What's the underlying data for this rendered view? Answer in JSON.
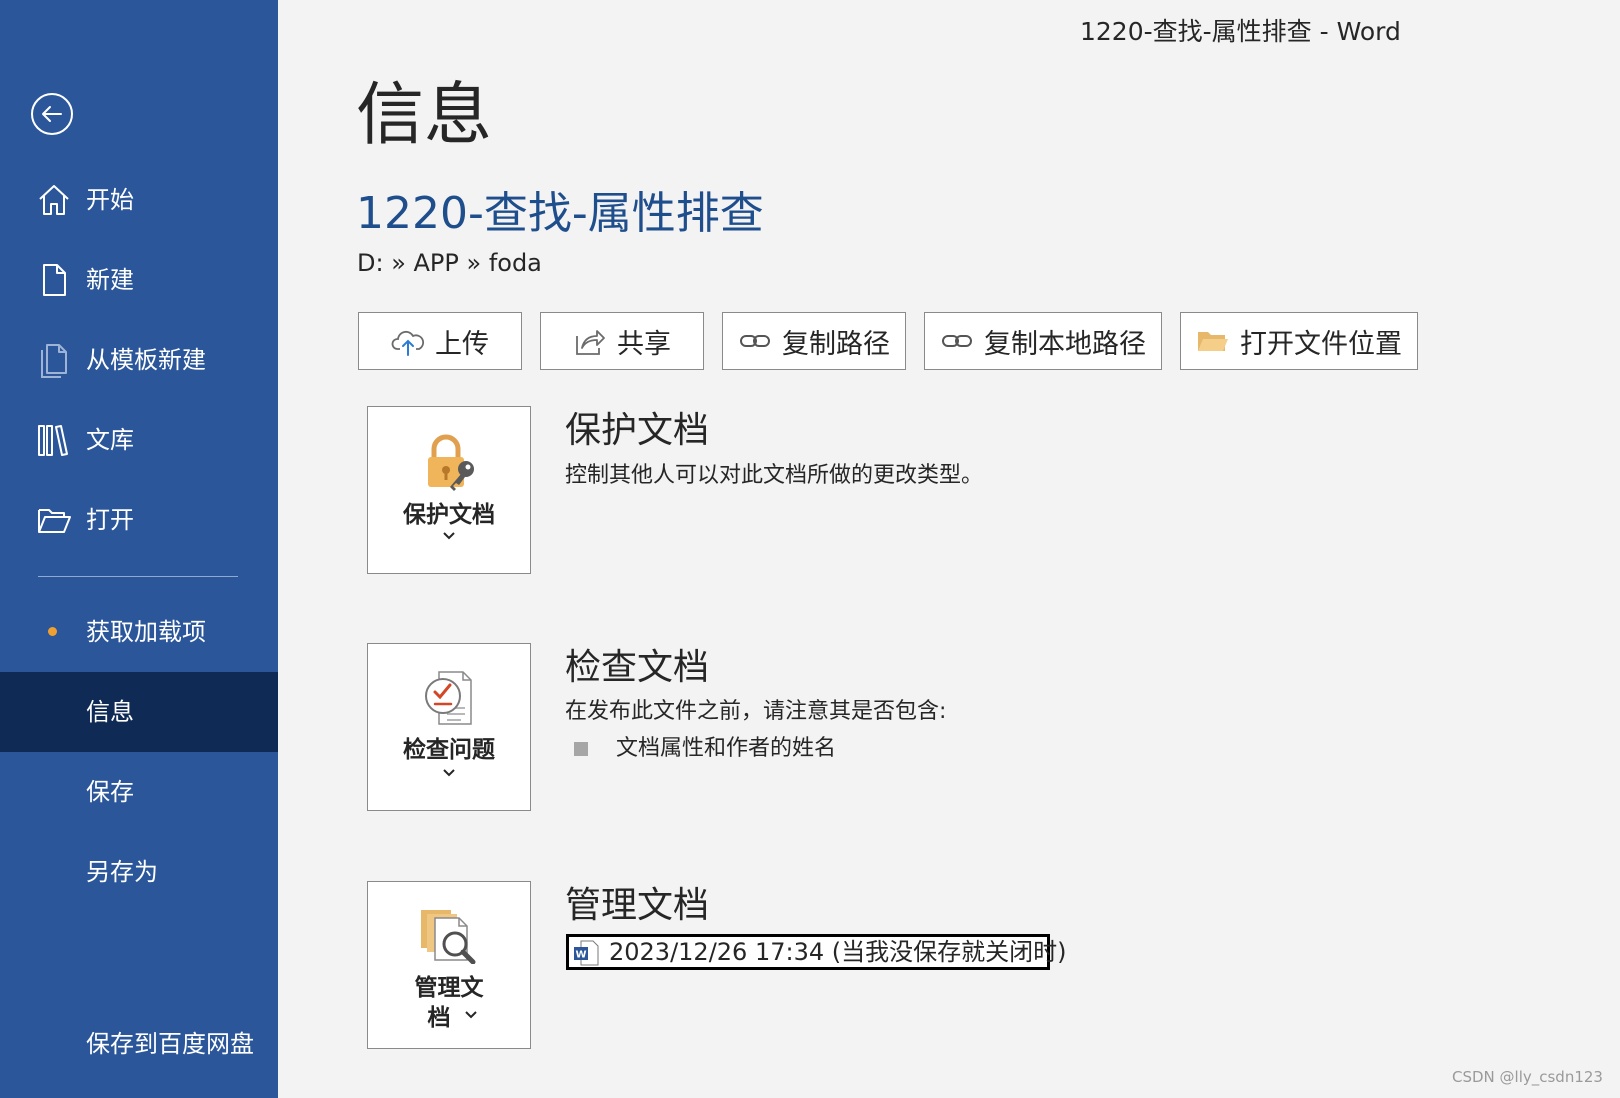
{
  "window": {
    "title": "1220-查找-属性排查  -  Word"
  },
  "sidebar": {
    "items": [
      {
        "label": "开始",
        "icon": "home-icon"
      },
      {
        "label": "新建",
        "icon": "new-document-icon"
      },
      {
        "label": "从模板新建",
        "icon": "template-icon"
      },
      {
        "label": "文库",
        "icon": "library-icon"
      },
      {
        "label": "打开",
        "icon": "open-folder-icon"
      },
      {
        "label": "获取加载项"
      },
      {
        "label": "信息",
        "active": true
      },
      {
        "label": "保存"
      },
      {
        "label": "另存为"
      },
      {
        "label": "保存到百度网盘"
      }
    ]
  },
  "main": {
    "title": "信息",
    "doc_title": "1220-查找-属性排查",
    "path": "D: » APP » foda",
    "actions": [
      {
        "label": "上传",
        "icon": "cloud-upload-icon"
      },
      {
        "label": "共享",
        "icon": "share-icon"
      },
      {
        "label": "复制路径",
        "icon": "link-icon"
      },
      {
        "label": "复制本地路径",
        "icon": "link-icon"
      },
      {
        "label": "打开文件位置",
        "icon": "folder-icon"
      }
    ],
    "protect": {
      "button_label": "保护文档",
      "title": "保护文档",
      "description": "控制其他人可以对此文档所做的更改类型。"
    },
    "inspect": {
      "button_label": "检查问题",
      "title": "检查文档",
      "description": "在发布此文件之前，请注意其是否包含:",
      "bullets": [
        "文档属性和作者的姓名"
      ]
    },
    "manage": {
      "button_label_line1": "管理文",
      "button_label_line2": "档",
      "title": "管理文档",
      "version_entry": "2023/12/26 17:34 (当我没保存就关闭时)"
    }
  },
  "watermark": "CSDN @lly_csdn123",
  "colors": {
    "sidebar": "#2b579a",
    "sidebar_active": "#0e2a55",
    "doc_title": "#1f4e8c",
    "background": "#f3f3f3"
  }
}
